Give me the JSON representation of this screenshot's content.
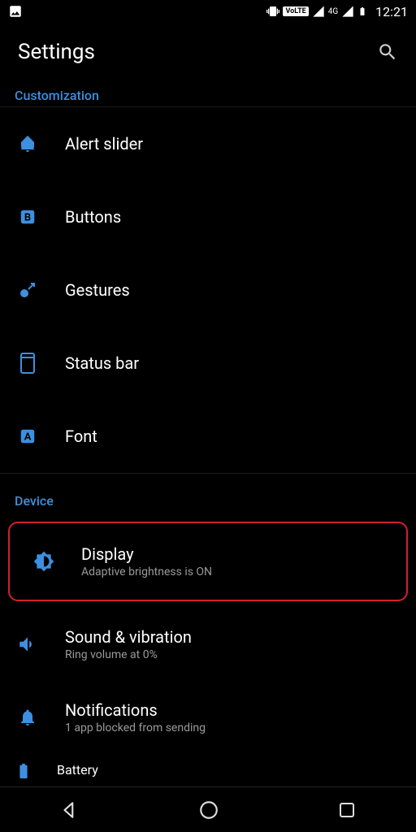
{
  "status": {
    "time": "12:21",
    "volte": "VoLTE",
    "signal_label": "4G"
  },
  "header": {
    "title": "Settings"
  },
  "sections": {
    "customization": {
      "title": "Customization",
      "alert_slider": "Alert slider",
      "buttons": "Buttons",
      "gestures": "Gestures",
      "status_bar": "Status bar",
      "font": "Font"
    },
    "device": {
      "title": "Device",
      "display": {
        "label": "Display",
        "sub": "Adaptive brightness is ON"
      },
      "sound": {
        "label": "Sound & vibration",
        "sub": "Ring volume at 0%"
      },
      "notifications": {
        "label": "Notifications",
        "sub": "1 app blocked from sending"
      },
      "battery": {
        "label": "Battery"
      }
    }
  }
}
